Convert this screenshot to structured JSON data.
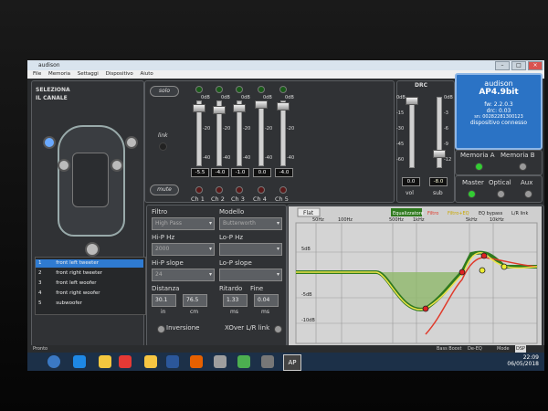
{
  "window": {
    "title": "audison",
    "buttons": [
      "–",
      "□",
      "×"
    ]
  },
  "menu": [
    "File",
    "Memoria",
    "Settaggi",
    "Dispositivo",
    "Aiuto"
  ],
  "channel_select": {
    "title_line1": "SELEZIONA",
    "title_line2": "IL CANALE"
  },
  "channels": [
    {
      "num": "1",
      "name": "front left tweeter",
      "selected": true
    },
    {
      "num": "2",
      "name": "front right tweeter",
      "selected": false
    },
    {
      "num": "3",
      "name": "front left woofer",
      "selected": false
    },
    {
      "num": "4",
      "name": "front right woofer",
      "selected": false
    },
    {
      "num": "5",
      "name": "subwoofer",
      "selected": false
    }
  ],
  "mixer": {
    "solo_label": "solo",
    "link_label": "link",
    "mute_label": "mute",
    "scale": [
      "0dB",
      "-20",
      "-40"
    ],
    "values": [
      "-5.5",
      "-4.0",
      "-1.0",
      "0.0",
      "-4.0"
    ],
    "ch_labels": [
      "Ch 1",
      "Ch 2",
      "Ch 3",
      "Ch 4",
      "Ch 5"
    ]
  },
  "drc": {
    "title": "DRC",
    "scale_vol": [
      "0dB",
      "-15",
      "-30",
      "-45",
      "-60"
    ],
    "scale_sub": [
      "0dB",
      "-3",
      "-6",
      "-9",
      "-12"
    ],
    "vol_value": "0.0",
    "sub_value": "-8.0",
    "vol_label": "vol",
    "sub_label": "sub"
  },
  "device": {
    "brand": "audison",
    "model": "AP4.9bit",
    "fw": "fw: 2.2.0.3",
    "drc": "drc: 0.03",
    "sn": "sn: 00282281300123",
    "status": "dispositivo connesso"
  },
  "memory": {
    "a": "Memoria A",
    "b": "Memoria B"
  },
  "inputs": {
    "master": "Master",
    "optical": "Optical",
    "aux": "Aux"
  },
  "filter": {
    "filtro_label": "Filtro",
    "filtro_value": "High Pass",
    "modello_label": "Modello",
    "modello_value": "Butterworth",
    "hip_hz_label": "Hi-P Hz",
    "hip_hz_value": "2000",
    "lop_hz_label": "Lo-P Hz",
    "hip_slope_label": "Hi-P slope",
    "hip_slope_value": "24",
    "lop_slope_label": "Lo-P slope",
    "distanza_label": "Distanza",
    "ritardo_label": "Ritardo",
    "fine_label": "Fine",
    "dist_in": "30.1",
    "dist_cm": "76.5",
    "rit_ms": "1.33",
    "fine_ms": "0.04",
    "unit_in": "in",
    "unit_cm": "cm",
    "unit_ms": "ms",
    "inversione": "Inversione",
    "xover": "XOver L/R link"
  },
  "eq": {
    "flat_label": "Flat",
    "equalizzatore": "Equalizzatore",
    "filtro": "Filtro",
    "filtro_eq": "Filtro+EQ",
    "eq_bypass": "EQ bypass",
    "lr_link": "L/R link",
    "freqs": [
      "50Hz",
      "100Hz",
      "500Hz",
      "1kHz",
      "5kHz",
      "10kHz"
    ],
    "db_labels": [
      "5dB",
      "-5dB",
      "-10dB"
    ],
    "bass_boost": "Bass Boost",
    "de_eq": "De-EQ",
    "mode": "Mode",
    "mode_value": "DSP",
    "colors": {
      "eq": "#2f7a1f",
      "filtro": "#e03a2b",
      "filtro_eq": "#f0e34a"
    }
  },
  "status_bar": "Pronto",
  "clock": {
    "time": "22:09",
    "date": "06/05/2018"
  },
  "taskbar_icons": [
    "windows-start-icon",
    "ie-icon",
    "file-explorer-icon",
    "chrome-icon",
    "folder-icon",
    "word-icon",
    "firefox-icon",
    "settings-icon",
    "photos-icon",
    "network-icon",
    "document-icon",
    "audison-app-icon"
  ],
  "taskbar_app_label": "AP"
}
